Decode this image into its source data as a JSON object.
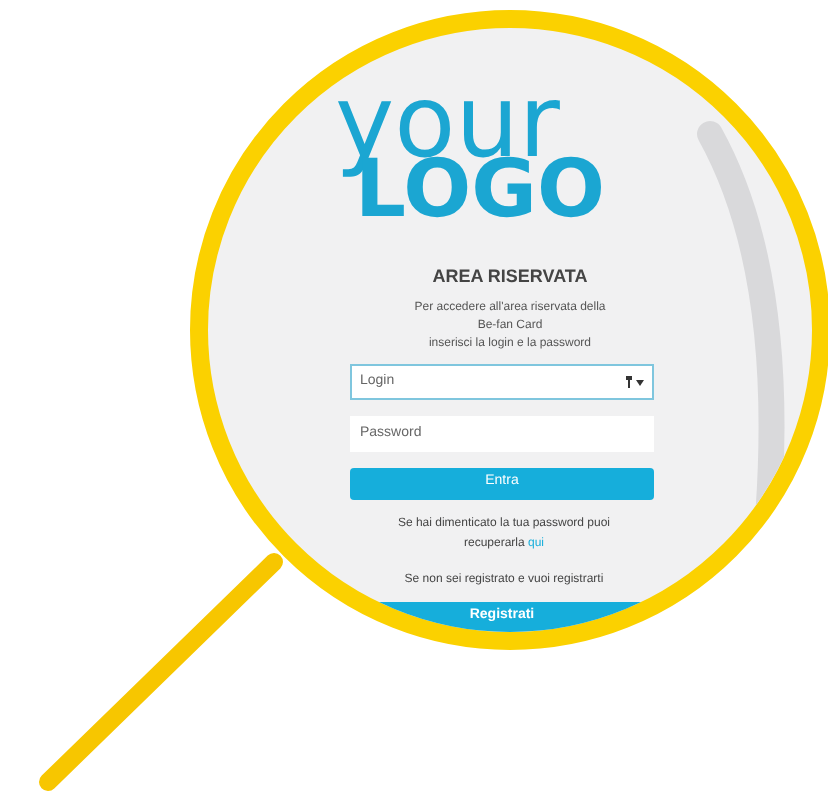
{
  "logo": {
    "line_1": "your",
    "line_2": "LOGO"
  },
  "title": "AREA RISERVATA",
  "description": "Per accedere all'area riservata della\nBe-fan Card\ninserisci la login e la password",
  "fields": [
    {
      "placeholder": "Login",
      "focused": true,
      "kind": "login"
    },
    {
      "placeholder": "Password",
      "focused": false,
      "kind": "password"
    }
  ],
  "login_button": "Entra",
  "forgot_text": "Se hai dimenticato la tua password puoi recuperarla",
  "forgot_link": "qui",
  "register_text": "Se non sei registrato e vuoi registrarti",
  "register_button": "Registrati"
}
